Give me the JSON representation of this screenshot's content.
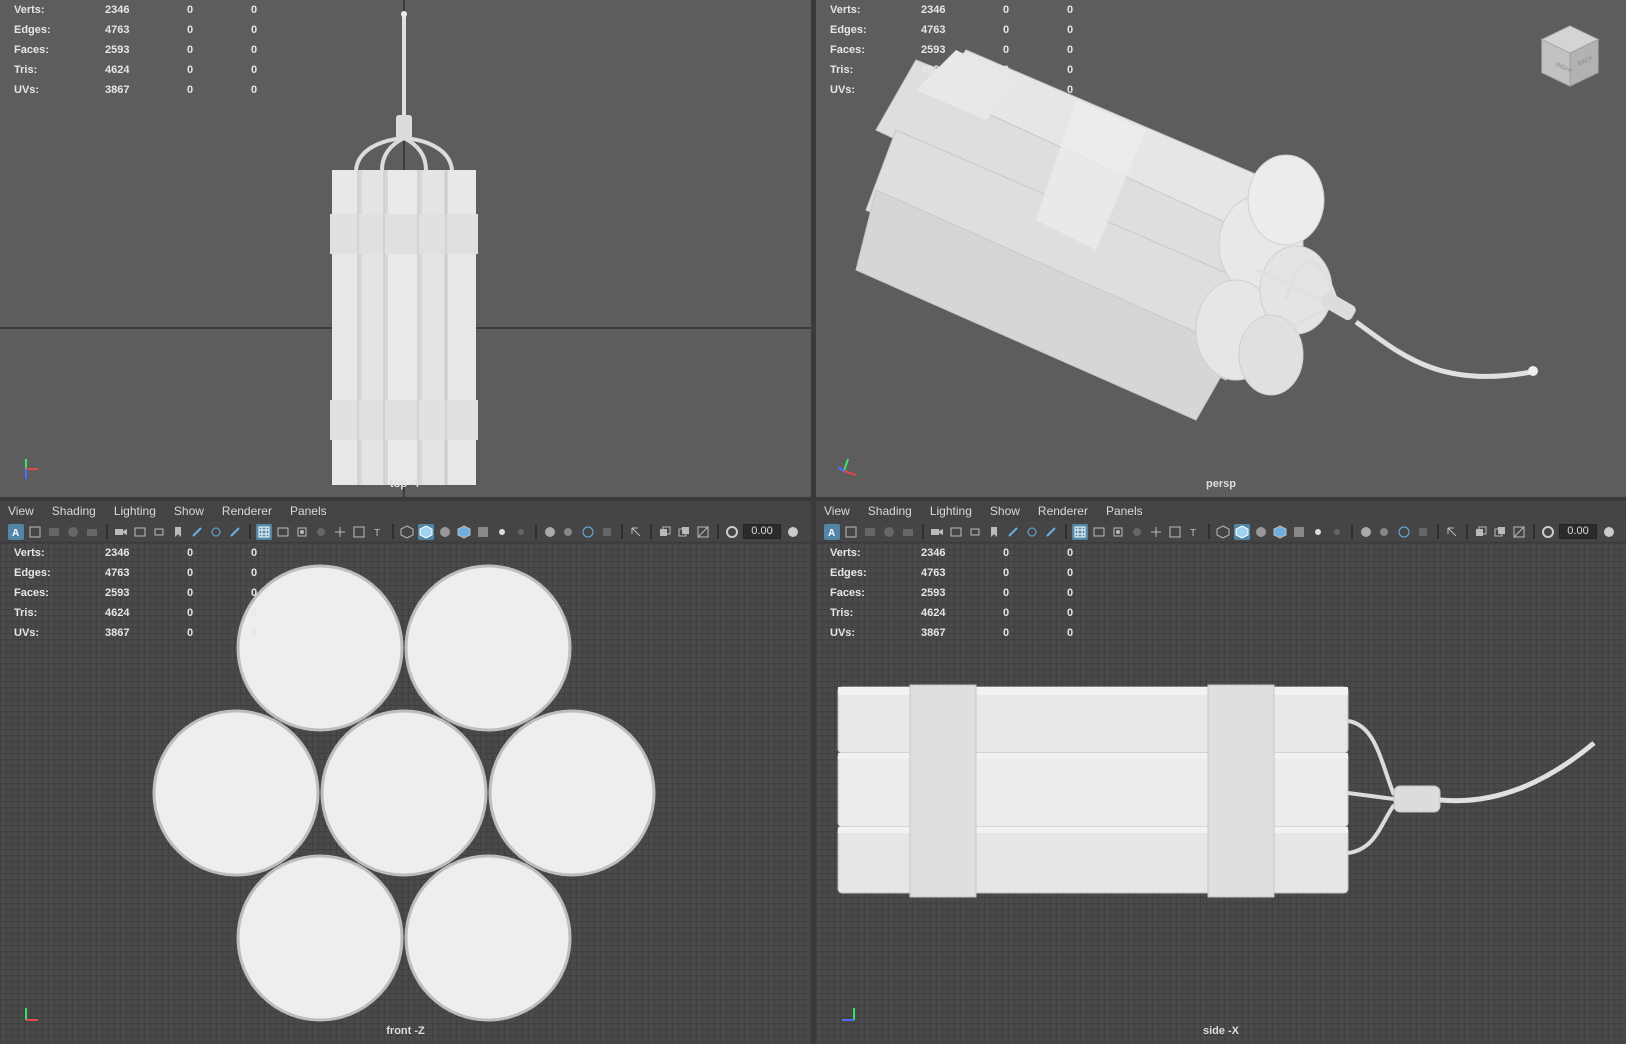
{
  "hud": {
    "rows": [
      {
        "label": "Verts:",
        "v1": "2346",
        "v2": "0",
        "v3": "0"
      },
      {
        "label": "Edges:",
        "v1": "4763",
        "v2": "0",
        "v3": "0"
      },
      {
        "label": "Faces:",
        "v1": "2593",
        "v2": "0",
        "v3": "0"
      },
      {
        "label": "Tris:",
        "v1": "4624",
        "v2": "0",
        "v3": "0"
      },
      {
        "label": "UVs:",
        "v1": "3867",
        "v2": "0",
        "v3": "0"
      }
    ]
  },
  "viewports": {
    "top": {
      "camera": "top -Y"
    },
    "persp": {
      "camera": "persp"
    },
    "front": {
      "camera": "front -Z"
    },
    "side": {
      "camera": "side -X"
    }
  },
  "panel_menu": {
    "items": [
      "View",
      "Shading",
      "Lighting",
      "Show",
      "Renderer",
      "Panels"
    ]
  },
  "toolbar": {
    "exposure_value": "0.00"
  },
  "view_cube": {
    "faces": [
      "RIGHT",
      "BACK"
    ]
  },
  "colors": {
    "mesh": "#e2e2e2",
    "flat_bg": "#5d5d5d",
    "grid_bg": "#4a4a4a",
    "active_icon": "#5285a6"
  }
}
